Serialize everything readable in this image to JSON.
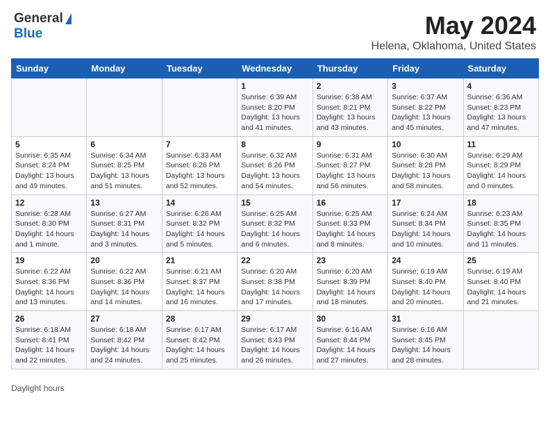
{
  "header": {
    "logo_general": "General",
    "logo_blue": "Blue",
    "title": "May 2024",
    "subtitle": "Helena, Oklahoma, United States"
  },
  "days_of_week": [
    "Sunday",
    "Monday",
    "Tuesday",
    "Wednesday",
    "Thursday",
    "Friday",
    "Saturday"
  ],
  "weeks": [
    [
      {
        "day": "",
        "sunrise": "",
        "sunset": "",
        "daylight": ""
      },
      {
        "day": "",
        "sunrise": "",
        "sunset": "",
        "daylight": ""
      },
      {
        "day": "",
        "sunrise": "",
        "sunset": "",
        "daylight": ""
      },
      {
        "day": "1",
        "sunrise": "Sunrise: 6:39 AM",
        "sunset": "Sunset: 8:20 PM",
        "daylight": "Daylight: 13 hours and 41 minutes."
      },
      {
        "day": "2",
        "sunrise": "Sunrise: 6:38 AM",
        "sunset": "Sunset: 8:21 PM",
        "daylight": "Daylight: 13 hours and 43 minutes."
      },
      {
        "day": "3",
        "sunrise": "Sunrise: 6:37 AM",
        "sunset": "Sunset: 8:22 PM",
        "daylight": "Daylight: 13 hours and 45 minutes."
      },
      {
        "day": "4",
        "sunrise": "Sunrise: 6:36 AM",
        "sunset": "Sunset: 8:23 PM",
        "daylight": "Daylight: 13 hours and 47 minutes."
      }
    ],
    [
      {
        "day": "5",
        "sunrise": "Sunrise: 6:35 AM",
        "sunset": "Sunset: 8:24 PM",
        "daylight": "Daylight: 13 hours and 49 minutes."
      },
      {
        "day": "6",
        "sunrise": "Sunrise: 6:34 AM",
        "sunset": "Sunset: 8:25 PM",
        "daylight": "Daylight: 13 hours and 51 minutes."
      },
      {
        "day": "7",
        "sunrise": "Sunrise: 6:33 AM",
        "sunset": "Sunset: 8:26 PM",
        "daylight": "Daylight: 13 hours and 52 minutes."
      },
      {
        "day": "8",
        "sunrise": "Sunrise: 6:32 AM",
        "sunset": "Sunset: 8:26 PM",
        "daylight": "Daylight: 13 hours and 54 minutes."
      },
      {
        "day": "9",
        "sunrise": "Sunrise: 6:31 AM",
        "sunset": "Sunset: 8:27 PM",
        "daylight": "Daylight: 13 hours and 56 minutes."
      },
      {
        "day": "10",
        "sunrise": "Sunrise: 6:30 AM",
        "sunset": "Sunset: 8:28 PM",
        "daylight": "Daylight: 13 hours and 58 minutes."
      },
      {
        "day": "11",
        "sunrise": "Sunrise: 6:29 AM",
        "sunset": "Sunset: 8:29 PM",
        "daylight": "Daylight: 14 hours and 0 minutes."
      }
    ],
    [
      {
        "day": "12",
        "sunrise": "Sunrise: 6:28 AM",
        "sunset": "Sunset: 8:30 PM",
        "daylight": "Daylight: 14 hours and 1 minute."
      },
      {
        "day": "13",
        "sunrise": "Sunrise: 6:27 AM",
        "sunset": "Sunset: 8:31 PM",
        "daylight": "Daylight: 14 hours and 3 minutes."
      },
      {
        "day": "14",
        "sunrise": "Sunrise: 6:26 AM",
        "sunset": "Sunset: 8:32 PM",
        "daylight": "Daylight: 14 hours and 5 minutes."
      },
      {
        "day": "15",
        "sunrise": "Sunrise: 6:25 AM",
        "sunset": "Sunset: 8:32 PM",
        "daylight": "Daylight: 14 hours and 6 minutes."
      },
      {
        "day": "16",
        "sunrise": "Sunrise: 6:25 AM",
        "sunset": "Sunset: 8:33 PM",
        "daylight": "Daylight: 14 hours and 8 minutes."
      },
      {
        "day": "17",
        "sunrise": "Sunrise: 6:24 AM",
        "sunset": "Sunset: 8:34 PM",
        "daylight": "Daylight: 14 hours and 10 minutes."
      },
      {
        "day": "18",
        "sunrise": "Sunrise: 6:23 AM",
        "sunset": "Sunset: 8:35 PM",
        "daylight": "Daylight: 14 hours and 11 minutes."
      }
    ],
    [
      {
        "day": "19",
        "sunrise": "Sunrise: 6:22 AM",
        "sunset": "Sunset: 8:36 PM",
        "daylight": "Daylight: 14 hours and 13 minutes."
      },
      {
        "day": "20",
        "sunrise": "Sunrise: 6:22 AM",
        "sunset": "Sunset: 8:36 PM",
        "daylight": "Daylight: 14 hours and 14 minutes."
      },
      {
        "day": "21",
        "sunrise": "Sunrise: 6:21 AM",
        "sunset": "Sunset: 8:37 PM",
        "daylight": "Daylight: 14 hours and 16 minutes."
      },
      {
        "day": "22",
        "sunrise": "Sunrise: 6:20 AM",
        "sunset": "Sunset: 8:38 PM",
        "daylight": "Daylight: 14 hours and 17 minutes."
      },
      {
        "day": "23",
        "sunrise": "Sunrise: 6:20 AM",
        "sunset": "Sunset: 8:39 PM",
        "daylight": "Daylight: 14 hours and 18 minutes."
      },
      {
        "day": "24",
        "sunrise": "Sunrise: 6:19 AM",
        "sunset": "Sunset: 8:40 PM",
        "daylight": "Daylight: 14 hours and 20 minutes."
      },
      {
        "day": "25",
        "sunrise": "Sunrise: 6:19 AM",
        "sunset": "Sunset: 8:40 PM",
        "daylight": "Daylight: 14 hours and 21 minutes."
      }
    ],
    [
      {
        "day": "26",
        "sunrise": "Sunrise: 6:18 AM",
        "sunset": "Sunset: 8:41 PM",
        "daylight": "Daylight: 14 hours and 22 minutes."
      },
      {
        "day": "27",
        "sunrise": "Sunrise: 6:18 AM",
        "sunset": "Sunset: 8:42 PM",
        "daylight": "Daylight: 14 hours and 24 minutes."
      },
      {
        "day": "28",
        "sunrise": "Sunrise: 6:17 AM",
        "sunset": "Sunset: 8:42 PM",
        "daylight": "Daylight: 14 hours and 25 minutes."
      },
      {
        "day": "29",
        "sunrise": "Sunrise: 6:17 AM",
        "sunset": "Sunset: 8:43 PM",
        "daylight": "Daylight: 14 hours and 26 minutes."
      },
      {
        "day": "30",
        "sunrise": "Sunrise: 6:16 AM",
        "sunset": "Sunset: 8:44 PM",
        "daylight": "Daylight: 14 hours and 27 minutes."
      },
      {
        "day": "31",
        "sunrise": "Sunrise: 6:16 AM",
        "sunset": "Sunset: 8:45 PM",
        "daylight": "Daylight: 14 hours and 28 minutes."
      },
      {
        "day": "",
        "sunrise": "",
        "sunset": "",
        "daylight": ""
      }
    ]
  ],
  "footer": {
    "daylight_hours_label": "Daylight hours"
  }
}
